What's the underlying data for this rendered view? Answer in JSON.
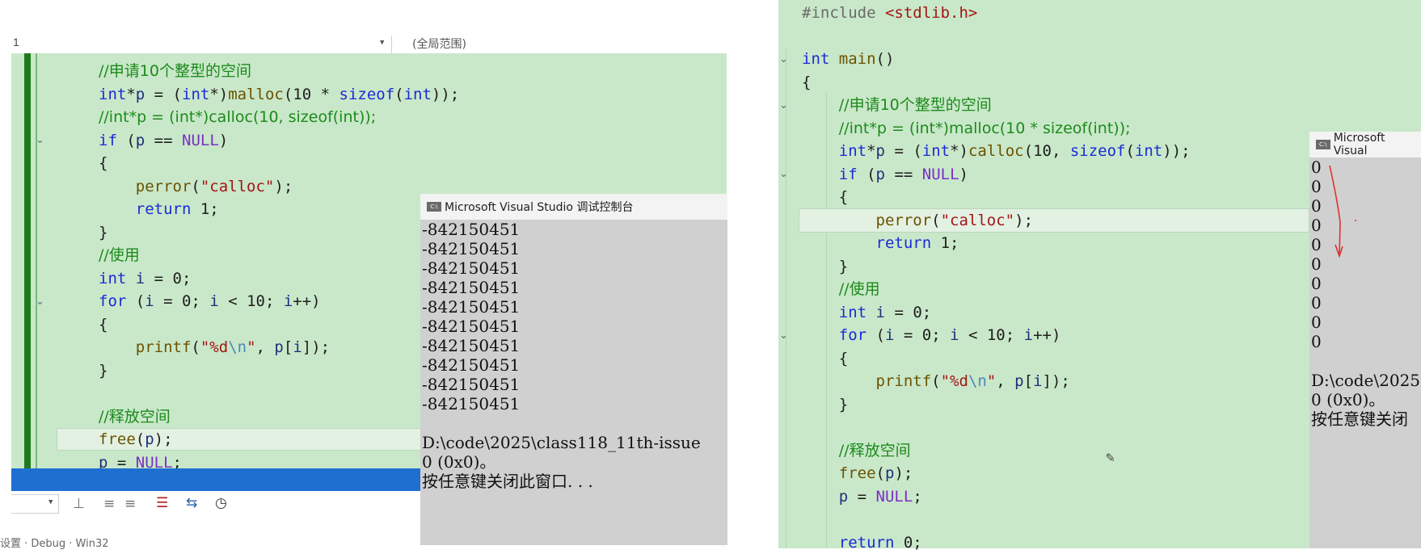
{
  "left_editor": {
    "scope_line": "1",
    "scope_label": "(全局范围)",
    "lines": [
      [
        [
          "cm",
          "//申请10个整型的空间"
        ]
      ],
      [
        [
          "ty",
          "int"
        ],
        [
          "p",
          "*"
        ],
        [
          "var",
          "p"
        ],
        [
          "p",
          " = ("
        ],
        [
          "ty",
          "int"
        ],
        [
          "p",
          "*)"
        ],
        [
          "fn",
          "malloc"
        ],
        [
          "p",
          "(10 * "
        ],
        [
          "kw",
          "sizeof"
        ],
        [
          "p",
          "("
        ],
        [
          "ty",
          "int"
        ],
        [
          "p",
          "));"
        ]
      ],
      [
        [
          "cm",
          "//int*p = (int*)calloc(10, sizeof(int));"
        ]
      ],
      [
        [
          "kw",
          "if"
        ],
        [
          "p",
          " ("
        ],
        [
          "var",
          "p"
        ],
        [
          "p",
          " == "
        ],
        [
          "mac",
          "NULL"
        ],
        [
          "p",
          ")"
        ]
      ],
      [
        [
          "p",
          "{"
        ]
      ],
      [
        [
          "p",
          "    "
        ],
        [
          "fn",
          "perror"
        ],
        [
          "p",
          "("
        ],
        [
          "st",
          "\"calloc\""
        ],
        [
          "p",
          ");"
        ]
      ],
      [
        [
          "p",
          "    "
        ],
        [
          "kw",
          "return"
        ],
        [
          "p",
          " 1;"
        ]
      ],
      [
        [
          "p",
          "}"
        ]
      ],
      [
        [
          "cm",
          "//使用"
        ]
      ],
      [
        [
          "ty",
          "int"
        ],
        [
          "p",
          " "
        ],
        [
          "var",
          "i"
        ],
        [
          "p",
          " = 0;"
        ]
      ],
      [
        [
          "kw",
          "for"
        ],
        [
          "p",
          " ("
        ],
        [
          "var",
          "i"
        ],
        [
          "p",
          " = 0; "
        ],
        [
          "var",
          "i"
        ],
        [
          "p",
          " < 10; "
        ],
        [
          "var",
          "i"
        ],
        [
          "p",
          "++)"
        ]
      ],
      [
        [
          "p",
          "{"
        ]
      ],
      [
        [
          "p",
          "    "
        ],
        [
          "fn",
          "printf"
        ],
        [
          "p",
          "("
        ],
        [
          "st",
          "\"%d"
        ],
        [
          "esc",
          "\\n"
        ],
        [
          "st",
          "\""
        ],
        [
          "p",
          ", "
        ],
        [
          "var",
          "p"
        ],
        [
          "p",
          "["
        ],
        [
          "var",
          "i"
        ],
        [
          "p",
          "]);"
        ]
      ],
      [
        [
          "p",
          "}"
        ]
      ],
      [
        [
          "p",
          ""
        ]
      ],
      [
        [
          "cm",
          "//释放空间"
        ]
      ],
      [
        [
          "fn",
          "free"
        ],
        [
          "p",
          "("
        ],
        [
          "var",
          "p"
        ],
        [
          "p",
          ");"
        ]
      ],
      [
        [
          "var",
          "p"
        ],
        [
          "p",
          " = "
        ],
        [
          "mac",
          "NULL"
        ],
        [
          "p",
          ";"
        ]
      ]
    ],
    "fold_markers": [
      "⌄",
      "⌄"
    ],
    "bottom_text": "设置 · Debug · Win32"
  },
  "console_left": {
    "title": "Microsoft Visual Studio 调试控制台",
    "icon": "C:\\",
    "output": "-842150451\n-842150451\n-842150451\n-842150451\n-842150451\n-842150451\n-842150451\n-842150451\n-842150451\n-842150451\n\nD:\\code\\2025\\class118_11th-issue\n0 (0x0)。\n按任意键关闭此窗口. . ."
  },
  "right_editor": {
    "lines": [
      [
        [
          "pp",
          "#include "
        ],
        [
          "st",
          "<stdlib.h>"
        ]
      ],
      [
        [
          "p",
          ""
        ]
      ],
      [
        [
          "ty",
          "int"
        ],
        [
          "p",
          " "
        ],
        [
          "fn",
          "main"
        ],
        [
          "p",
          "()"
        ]
      ],
      [
        [
          "p",
          "{"
        ]
      ],
      [
        [
          "p",
          "    "
        ],
        [
          "cm",
          "//申请10个整型的空间"
        ]
      ],
      [
        [
          "p",
          "    "
        ],
        [
          "cm",
          "//int*p = (int*)malloc(10 * sizeof(int));"
        ]
      ],
      [
        [
          "p",
          "    "
        ],
        [
          "ty",
          "int"
        ],
        [
          "p",
          "*"
        ],
        [
          "var",
          "p"
        ],
        [
          "p",
          " = ("
        ],
        [
          "ty",
          "int"
        ],
        [
          "p",
          "*)"
        ],
        [
          "fn",
          "calloc"
        ],
        [
          "p",
          "(10, "
        ],
        [
          "kw",
          "sizeof"
        ],
        [
          "p",
          "("
        ],
        [
          "ty",
          "int"
        ],
        [
          "p",
          "));"
        ]
      ],
      [
        [
          "p",
          "    "
        ],
        [
          "kw",
          "if"
        ],
        [
          "p",
          " ("
        ],
        [
          "var",
          "p"
        ],
        [
          "p",
          " == "
        ],
        [
          "mac",
          "NULL"
        ],
        [
          "p",
          ")"
        ]
      ],
      [
        [
          "p",
          "    {"
        ]
      ],
      [
        [
          "p",
          "        "
        ],
        [
          "fn",
          "perror"
        ],
        [
          "p",
          "("
        ],
        [
          "st",
          "\"calloc\""
        ],
        [
          "p",
          ");"
        ]
      ],
      [
        [
          "p",
          "        "
        ],
        [
          "kw",
          "return"
        ],
        [
          "p",
          " 1;"
        ]
      ],
      [
        [
          "p",
          "    }"
        ]
      ],
      [
        [
          "p",
          "    "
        ],
        [
          "cm",
          "//使用"
        ]
      ],
      [
        [
          "p",
          "    "
        ],
        [
          "ty",
          "int"
        ],
        [
          "p",
          " "
        ],
        [
          "var",
          "i"
        ],
        [
          "p",
          " = 0;"
        ]
      ],
      [
        [
          "p",
          "    "
        ],
        [
          "kw",
          "for"
        ],
        [
          "p",
          " ("
        ],
        [
          "var",
          "i"
        ],
        [
          "p",
          " = 0; "
        ],
        [
          "var",
          "i"
        ],
        [
          "p",
          " < 10; "
        ],
        [
          "var",
          "i"
        ],
        [
          "p",
          "++)"
        ]
      ],
      [
        [
          "p",
          "    {"
        ]
      ],
      [
        [
          "p",
          "        "
        ],
        [
          "fn",
          "printf"
        ],
        [
          "p",
          "("
        ],
        [
          "st",
          "\"%d"
        ],
        [
          "esc",
          "\\n"
        ],
        [
          "st",
          "\""
        ],
        [
          "p",
          ", "
        ],
        [
          "var",
          "p"
        ],
        [
          "p",
          "["
        ],
        [
          "var",
          "i"
        ],
        [
          "p",
          "]);"
        ]
      ],
      [
        [
          "p",
          "    }"
        ]
      ],
      [
        [
          "p",
          ""
        ]
      ],
      [
        [
          "p",
          "    "
        ],
        [
          "cm",
          "//释放空间"
        ]
      ],
      [
        [
          "p",
          "    "
        ],
        [
          "fn",
          "free"
        ],
        [
          "p",
          "("
        ],
        [
          "var",
          "p"
        ],
        [
          "p",
          ");"
        ]
      ],
      [
        [
          "p",
          "    "
        ],
        [
          "var",
          "p"
        ],
        [
          "p",
          " = "
        ],
        [
          "mac",
          "NULL"
        ],
        [
          "p",
          ";"
        ]
      ],
      [
        [
          "p",
          ""
        ]
      ],
      [
        [
          "p",
          "    "
        ],
        [
          "kw",
          "return"
        ],
        [
          "p",
          " 0;"
        ]
      ]
    ]
  },
  "console_right": {
    "title": "Microsoft Visual",
    "icon": "C:\\",
    "output": "0\n0\n0\n0\n0\n0\n0\n0\n0\n0\n\nD:\\code\\2025\n0 (0x0)。\n按任意键关闭"
  },
  "colors": {
    "editor_bg": "#c9e8c9",
    "keyword": "#1b2ad6",
    "comment": "#1d8a1d",
    "string": "#a31515",
    "macro": "#7a2fc5",
    "status_bar": "#1f6fd1",
    "console_bg": "#d0d0d0"
  }
}
